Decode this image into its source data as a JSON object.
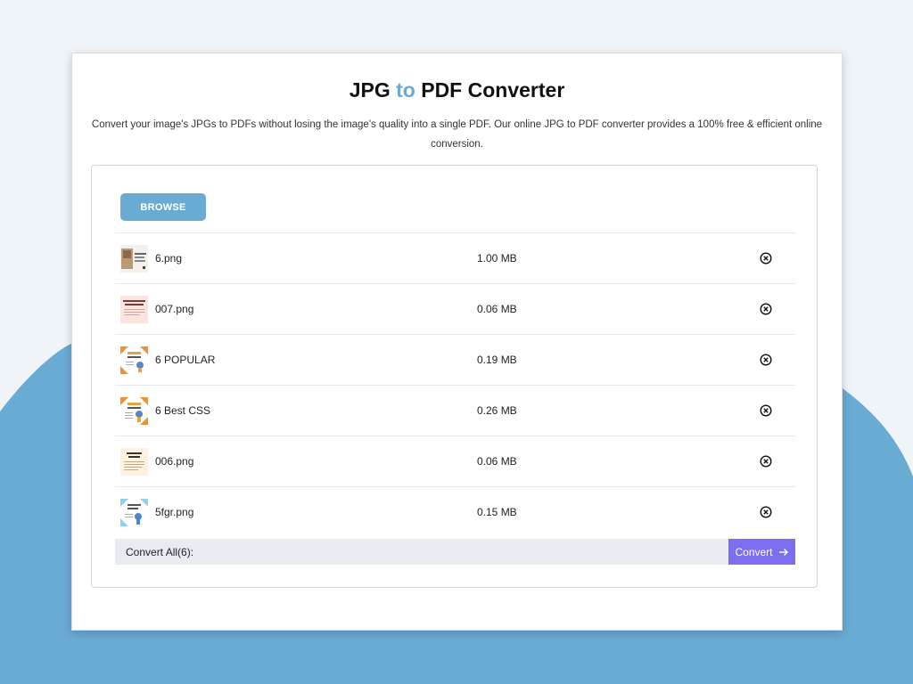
{
  "colors": {
    "page_background": "#eef4f8",
    "wave_blue": "#6aabd4",
    "accent_blue": "#6aabd4",
    "convert_purple": "#7b6ff0",
    "convert_bar": "#e8ebf1"
  },
  "header": {
    "title_part1": "JPG",
    "title_accent": "to",
    "title_part2": "PDF Converter",
    "description": "Convert your image's JPGs to PDFs without losing the image's quality into a single PDF. Our online JPG to PDF converter provides a 100% free & efficient online conversion."
  },
  "uploader": {
    "browse_label": "BROWSE",
    "files": [
      {
        "name": "6.png",
        "size": "1.00 MB",
        "thumb": "photo-thumbnail",
        "remove_icon": "close-circle-icon"
      },
      {
        "name": "007.png",
        "size": "0.06 MB",
        "thumb": "pink-text-thumbnail",
        "remove_icon": "close-circle-icon"
      },
      {
        "name": "6 POPULAR",
        "size": "0.19 MB",
        "thumb": "orange-frame-thumbnail",
        "remove_icon": "close-circle-icon"
      },
      {
        "name": "6 Best CSS",
        "size": "0.26 MB",
        "thumb": "orange-frame-thumbnail",
        "remove_icon": "close-circle-icon"
      },
      {
        "name": "006.png",
        "size": "0.06 MB",
        "thumb": "cream-text-thumbnail",
        "remove_icon": "close-circle-icon"
      },
      {
        "name": "5fgr.png",
        "size": "0.15 MB",
        "thumb": "blue-frame-thumbnail",
        "remove_icon": "close-circle-icon"
      }
    ],
    "convert_all_label": "Convert All(6):",
    "convert_label": "Convert",
    "convert_icon": "arrow-right-icon"
  }
}
